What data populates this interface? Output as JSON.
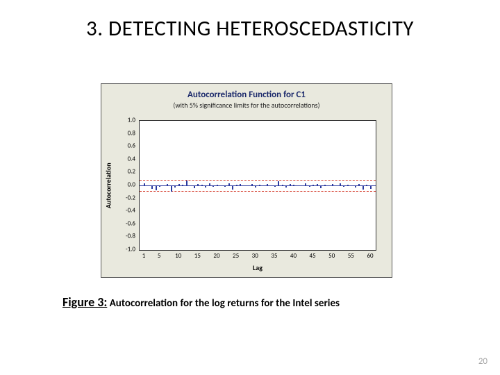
{
  "heading": "3. DETECTING HETEROSCEDASTICITY",
  "caption_lead": "Figure 3:",
  "caption_rest": " Autocorrelation for the log returns for the Intel series",
  "page_number": "20",
  "chart_data": {
    "type": "bar",
    "title": "Autocorrelation Function for C1",
    "subtitle": "(with 5% significance limits for the autocorrelations)",
    "xlabel": "Lag",
    "ylabel": "Autocorrelation",
    "ylim": [
      -1.0,
      1.0
    ],
    "y_ticks": [
      "1.0",
      "0.8",
      "0.6",
      "0.4",
      "0.2",
      "0.0",
      "-0.2",
      "-0.4",
      "-0.6",
      "-0.8",
      "-1.0"
    ],
    "x_ticks": [
      1,
      5,
      10,
      15,
      20,
      25,
      30,
      35,
      40,
      45,
      50,
      55,
      60
    ],
    "sig_upper": 0.09,
    "sig_lower": -0.09,
    "lags": [
      1,
      2,
      3,
      4,
      5,
      6,
      7,
      8,
      9,
      10,
      11,
      12,
      13,
      14,
      15,
      16,
      17,
      18,
      19,
      20,
      21,
      22,
      23,
      24,
      25,
      26,
      27,
      28,
      29,
      30,
      31,
      32,
      33,
      34,
      35,
      36,
      37,
      38,
      39,
      40,
      41,
      42,
      43,
      44,
      45,
      46,
      47,
      48,
      49,
      50,
      51,
      52,
      53,
      54,
      55,
      56,
      57,
      58,
      59,
      60
    ],
    "values": [
      0.03,
      -0.01,
      -0.05,
      -0.08,
      -0.02,
      -0.01,
      0.02,
      -0.1,
      -0.03,
      0.02,
      0.01,
      0.08,
      -0.01,
      -0.04,
      0.02,
      0.01,
      -0.03,
      0.03,
      -0.02,
      0.01,
      0.0,
      -0.02,
      0.03,
      -0.06,
      0.01,
      0.02,
      -0.01,
      0.0,
      0.02,
      -0.03,
      0.01,
      -0.01,
      0.02,
      0.0,
      -0.02,
      0.06,
      0.01,
      -0.03,
      0.02,
      0.01,
      -0.01,
      0.0,
      0.03,
      -0.02,
      0.01,
      0.02,
      -0.04,
      0.01,
      0.0,
      0.02,
      -0.01,
      0.03,
      -0.02,
      0.01,
      0.0,
      -0.03,
      0.02,
      -0.06,
      0.01,
      -0.05
    ]
  }
}
